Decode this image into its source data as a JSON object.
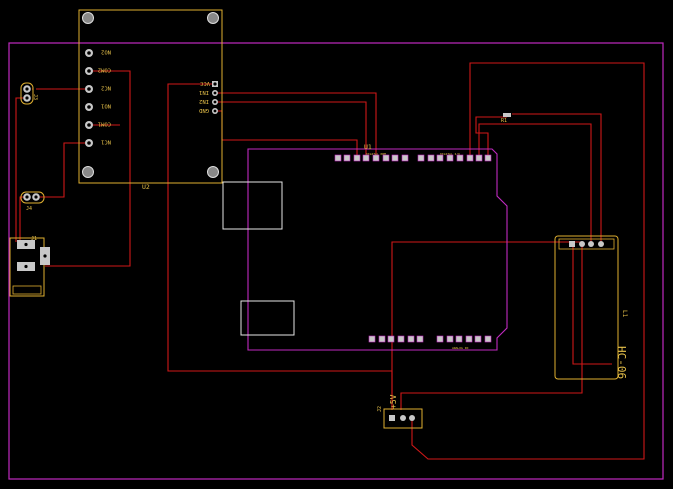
{
  "colors": {
    "background": "#000000",
    "board_outline": "#c02ac0",
    "silkscreen": "#e0b030",
    "copper_trace": "#d01818",
    "pad_fill": "#c8c8c8",
    "pad_hole": "#000000",
    "white_outline": "#e6e6e6"
  },
  "relay_module": {
    "designator": "U2",
    "pins_left": [
      "NO2",
      "COM2",
      "NC2",
      "NO1",
      "COM1",
      "NC1"
    ],
    "pins_right": [
      "VCC",
      "IN1",
      "IN2",
      "GND"
    ]
  },
  "arduino": {
    "designator": "U1",
    "header_top_left_label": "DIGITAL PWM",
    "header_top_right_label": "DIGITAL I/O",
    "header_bottom_right_label": "ANALOG IN"
  },
  "bluetooth": {
    "designator": "L1",
    "label": "HC-06"
  },
  "power_connector": {
    "designator": "J2",
    "label": "+5V"
  },
  "dc_jack": {
    "designator": "J1"
  },
  "terminal_top": {
    "designator": "J3"
  },
  "terminal_mid": {
    "designator": "J4"
  },
  "resistor": {
    "designator": "R1"
  }
}
